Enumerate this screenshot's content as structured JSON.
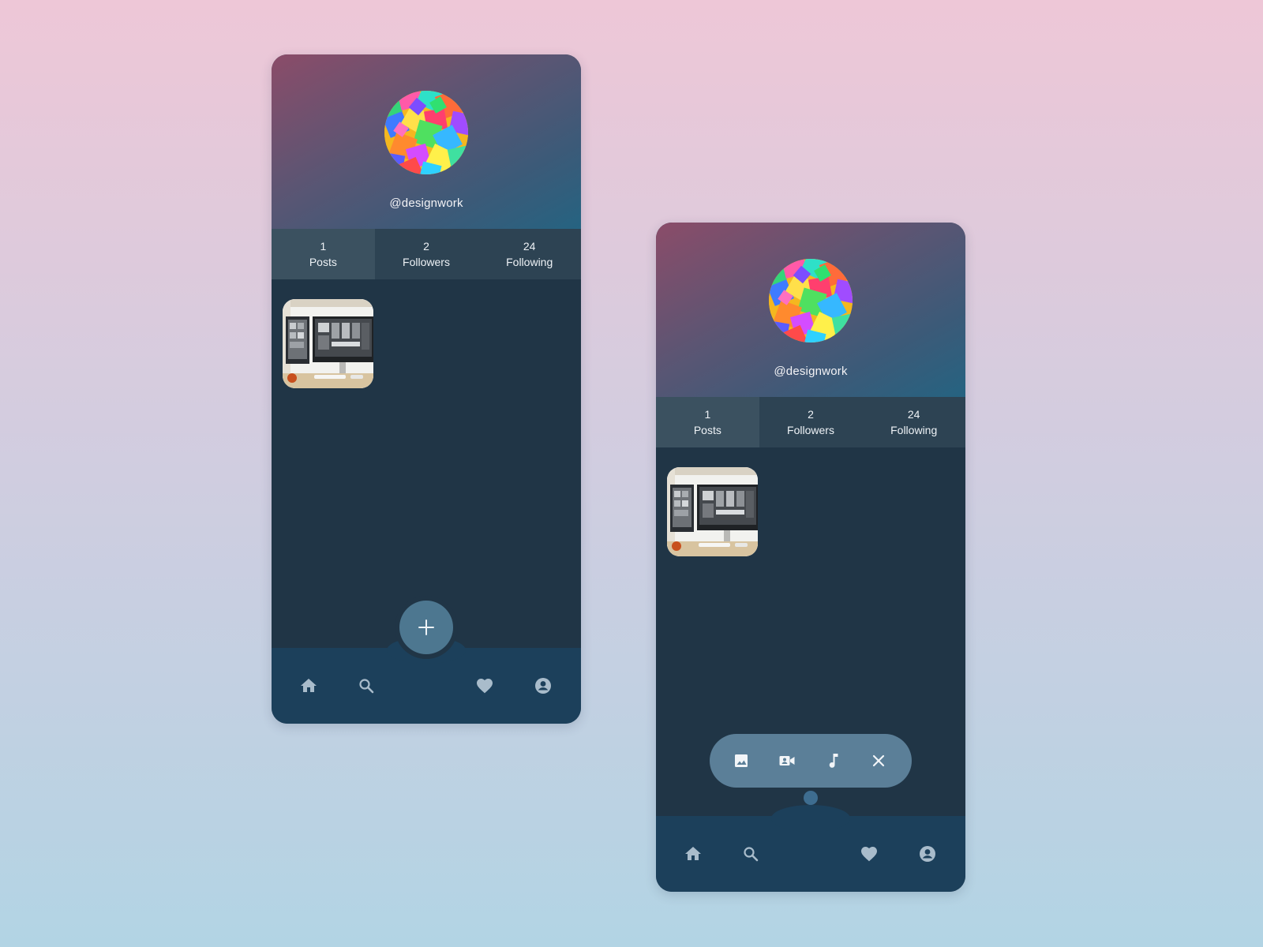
{
  "profile": {
    "username": "@designwork",
    "stats": [
      {
        "value": "1",
        "label": "Posts"
      },
      {
        "value": "2",
        "label": "Followers"
      },
      {
        "value": "24",
        "label": "Following"
      }
    ]
  },
  "bottom_nav": [
    "home-icon",
    "search-icon",
    "heart-icon",
    "account-icon"
  ],
  "fab": {
    "label": "+"
  },
  "media_menu": [
    "image-icon",
    "video-call-icon",
    "music-note-icon",
    "close-icon"
  ],
  "colors": {
    "card_bg": "#203546",
    "stats_bg": "#2d4353",
    "nav_bg": "#1c405b",
    "accent": "#4d7790"
  }
}
